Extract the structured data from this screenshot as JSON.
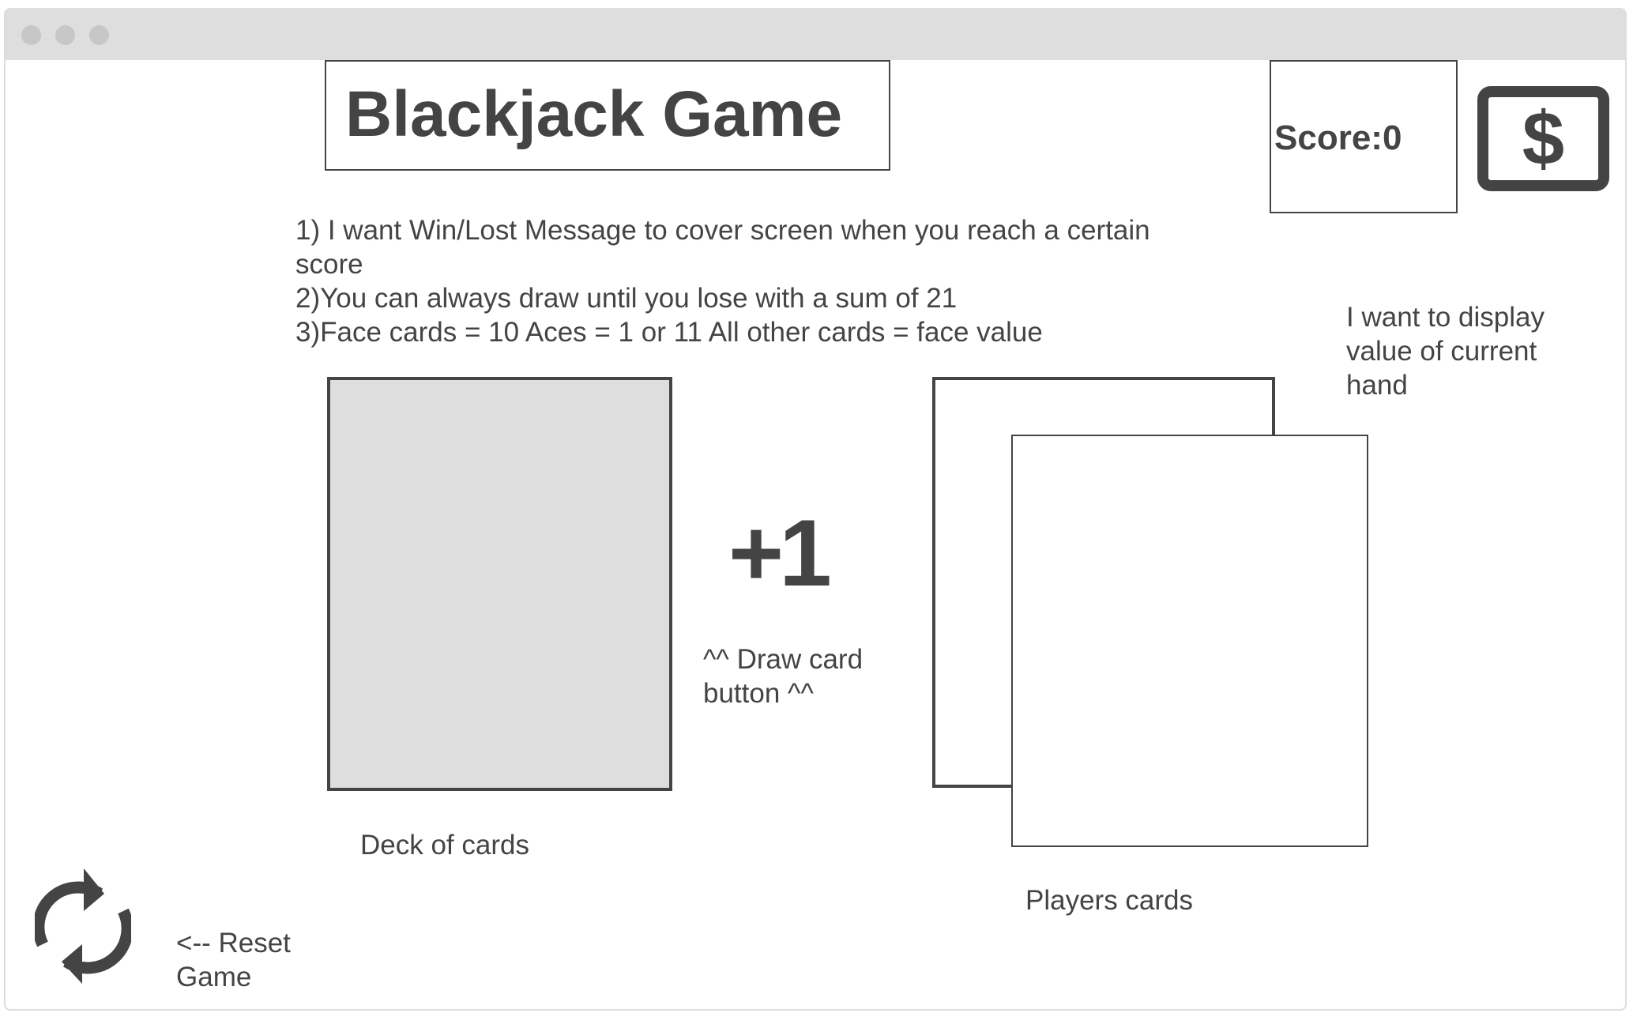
{
  "title": "Blackjack Game",
  "score": {
    "label": "Score:0"
  },
  "instructions": [
    "1) I want Win/Lost Message to cover screen when you reach a certain",
    "score",
    "2)You can always draw until you lose with a sum of 21",
    "3)Face cards = 10 Aces = 1 or 11 All other cards = face value"
  ],
  "notes": {
    "hand_value": [
      "I want to display",
      "value of current",
      "hand"
    ],
    "draw_button": [
      "^^ Draw card",
      "button ^^"
    ],
    "reset": [
      "<-- Reset",
      "Game"
    ]
  },
  "draw_button_label": "+1",
  "deck_label": "Deck of cards",
  "players_cards_label": "Players cards",
  "icons": {
    "money": "dollar-icon",
    "reset": "refresh-icon"
  },
  "colors": {
    "ink": "#444444",
    "titlebar": "#dedede",
    "deck_fill": "#dedede"
  }
}
